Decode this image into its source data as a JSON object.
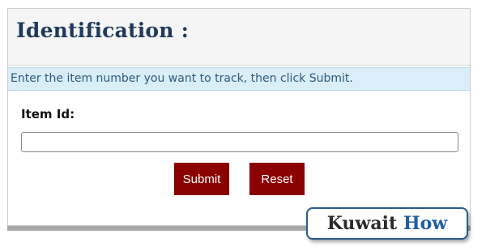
{
  "panel": {
    "title": "Identification :",
    "instruction": "Enter the item number you want to track, then click Submit."
  },
  "form": {
    "field_label": "Item Id:",
    "item_id_value": "",
    "submit_label": "Submit",
    "reset_label": "Reset"
  },
  "watermark": {
    "word1": "Kuwait",
    "word2": "How"
  },
  "colors": {
    "title": "#1f3a5a",
    "instruction_bg": "#d9eef7",
    "instruction_text": "#2d5a7a",
    "button_bg": "#8b0000",
    "watermark_border": "#2a5c8a",
    "watermark_accent": "#1f5fa0"
  }
}
